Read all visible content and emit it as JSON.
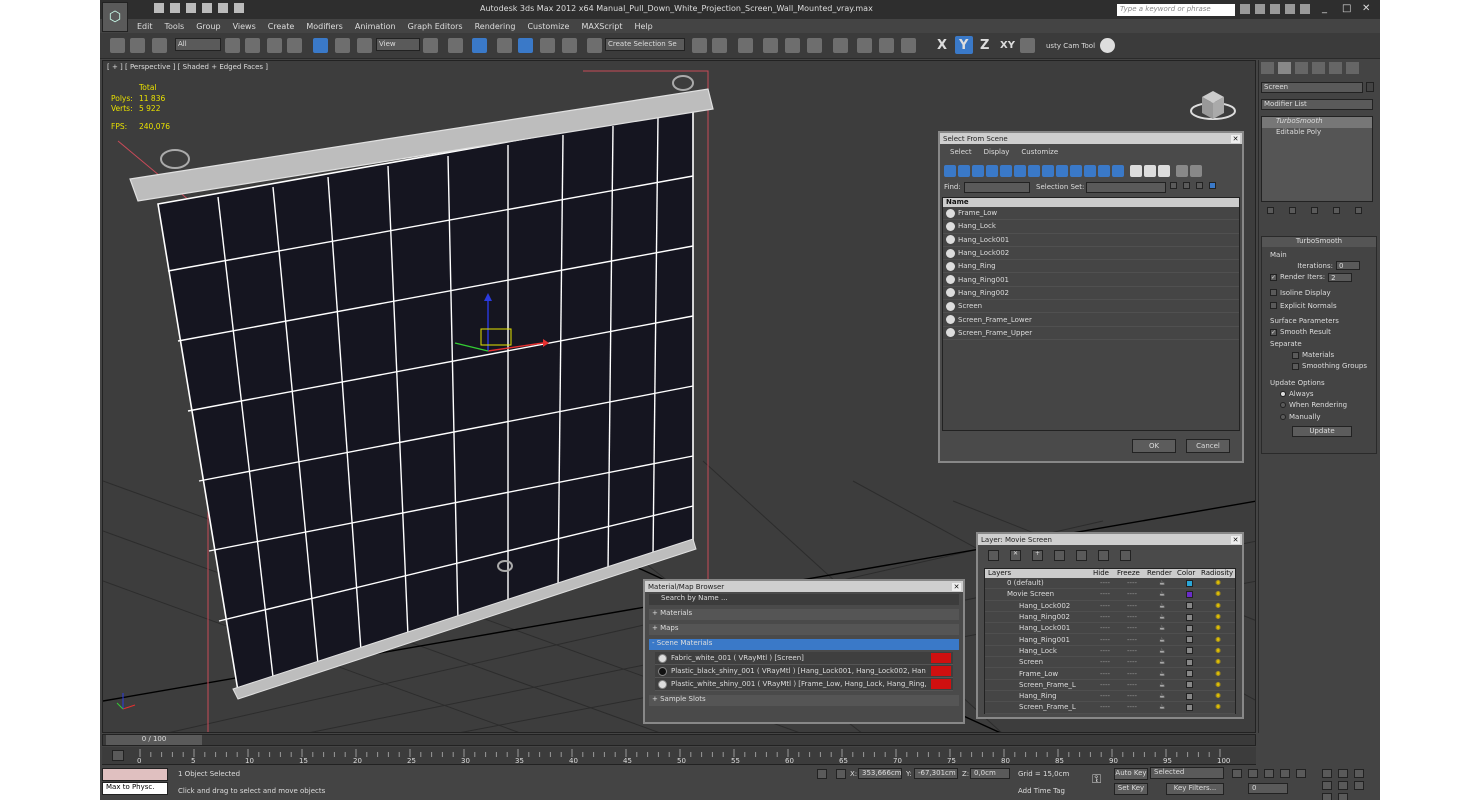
{
  "window": {
    "title": "Autodesk 3ds Max  2012 x64      Manual_Pull_Down_White_Projection_Screen_Wall_Mounted_vray.max",
    "search_placeholder": "Type a keyword or phrase"
  },
  "menu": [
    "Edit",
    "Tools",
    "Group",
    "Views",
    "Create",
    "Modifiers",
    "Animation",
    "Graph Editors",
    "Rendering",
    "Customize",
    "MAXScript",
    "Help"
  ],
  "toolbar": {
    "filter": "All",
    "refcoord": "View",
    "selection_set": "Create Selection Se",
    "axes": [
      "X",
      "Y",
      "Z",
      "XY"
    ],
    "cam_tool": "usty Cam Tool"
  },
  "viewport": {
    "label": "[ + ] [ Perspective ] [ Shaded + Edged Faces ]",
    "stats": {
      "total": "Total",
      "polys_label": "Polys:",
      "polys": "11 836",
      "verts_label": "Verts:",
      "verts": "5 922",
      "fps_label": "FPS:",
      "fps": "240,076"
    }
  },
  "command_panel": {
    "name": "Screen",
    "modifier_list": "Modifier List",
    "stack": [
      "TurboSmooth",
      "Editable Poly"
    ],
    "turbosmooth": {
      "title": "TurboSmooth",
      "main": "Main",
      "iterations_label": "Iterations:",
      "iterations": "0",
      "render_iters_label": "Render Iters:",
      "render_iters": "2",
      "isoline": "Isoline Display",
      "explicit": "Explicit Normals",
      "surface_params": "Surface Parameters",
      "smooth_result": "Smooth Result",
      "separate": "Separate",
      "materials": "Materials",
      "smoothing_groups": "Smoothing Groups",
      "update_options": "Update Options",
      "always": "Always",
      "when_rendering": "When Rendering",
      "manually": "Manually",
      "update": "Update"
    }
  },
  "select_dialog": {
    "title": "Select From Scene",
    "menu": [
      "Select",
      "Display",
      "Customize"
    ],
    "find": "Find:",
    "selection_set": "Selection Set:",
    "col_name": "Name",
    "items": [
      "Frame_Low",
      "Hang_Lock",
      "Hang_Lock001",
      "Hang_Lock002",
      "Hang_Ring",
      "Hang_Ring001",
      "Hang_Ring002",
      "Screen",
      "Screen_Frame_Lower",
      "Screen_Frame_Upper"
    ],
    "ok": "OK",
    "cancel": "Cancel"
  },
  "layer_dialog": {
    "title": "Layer: Movie Screen",
    "cols": [
      "Layers",
      "Hide",
      "Freeze",
      "Render",
      "Color",
      "Radiosity"
    ],
    "rows": [
      {
        "name": "0 (default)",
        "indent": 0,
        "color": "#2aa6d8"
      },
      {
        "name": "Movie Screen",
        "indent": 0,
        "color": "#6a2bc8"
      },
      {
        "name": "Hang_Lock002",
        "indent": 1,
        "color": "#888888"
      },
      {
        "name": "Hang_Ring002",
        "indent": 1,
        "color": "#888888"
      },
      {
        "name": "Hang_Lock001",
        "indent": 1,
        "color": "#888888"
      },
      {
        "name": "Hang_Ring001",
        "indent": 1,
        "color": "#888888"
      },
      {
        "name": "Hang_Lock",
        "indent": 1,
        "color": "#888888"
      },
      {
        "name": "Screen",
        "indent": 1,
        "color": "#888888"
      },
      {
        "name": "Frame_Low",
        "indent": 1,
        "color": "#888888"
      },
      {
        "name": "Screen_Frame_L",
        "indent": 1,
        "color": "#888888"
      },
      {
        "name": "Hang_Ring",
        "indent": 1,
        "color": "#888888"
      },
      {
        "name": "Screen_Frame_L",
        "indent": 1,
        "color": "#888888"
      }
    ]
  },
  "material_browser": {
    "title": "Material/Map Browser",
    "search": "Search by Name ...",
    "sections": [
      "+ Materials",
      "+ Maps",
      "- Scene Materials",
      "+ Sample Slots"
    ],
    "materials": [
      "Fabric_white_001  ( VRayMtl )  [Screen]",
      "Plastic_black_shiny_001  ( VRayMtl )  [Hang_Lock001, Hang_Lock002, Hang_Rin...",
      "Plastic_white_shiny_001  ( VRayMtl )  [Frame_Low, Hang_Lock, Hang_Ring, Scre..."
    ]
  },
  "timeline": {
    "frame": "0 / 100",
    "ticks": [
      "0",
      "5",
      "10",
      "15",
      "20",
      "25",
      "30",
      "35",
      "40",
      "45",
      "50",
      "55",
      "60",
      "65",
      "70",
      "75",
      "80",
      "85",
      "90",
      "95",
      "100"
    ]
  },
  "status": {
    "script": "Max to Physc.",
    "selected": "1 Object Selected",
    "prompt": "Click and drag to select and move objects",
    "x_label": "X:",
    "x": "353,666cm",
    "y_label": "Y:",
    "y": "-67,301cm",
    "z_label": "Z:",
    "z": "0,0cm",
    "grid": "Grid = 15,0cm",
    "add_time_tag": "Add Time Tag",
    "auto_key": "Auto Key",
    "set_key": "Set Key",
    "selected_dd": "Selected",
    "key_filters": "Key Filters...",
    "frame": "0"
  }
}
